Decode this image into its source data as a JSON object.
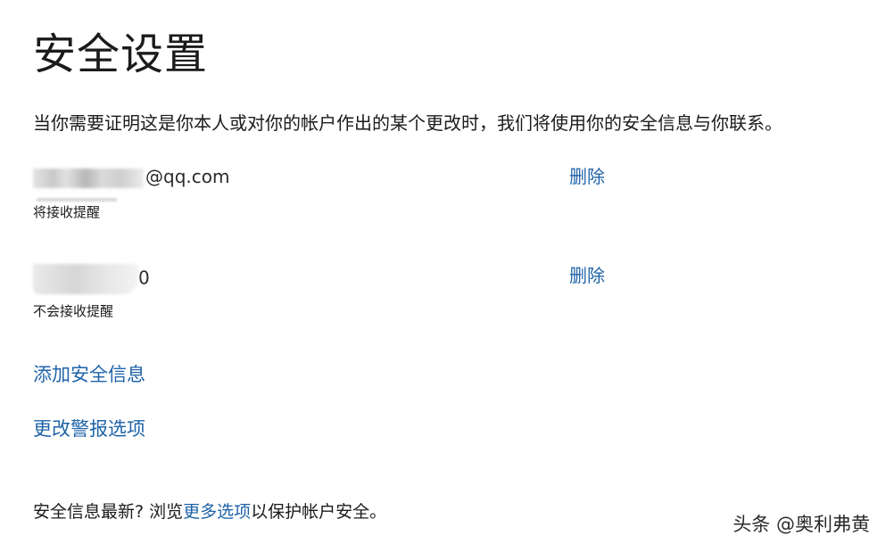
{
  "page": {
    "title": "安全设置",
    "description": "当你需要证明这是你本人或对你的帐户作出的某个更改时，我们将使用你的安全信息与你联系。"
  },
  "security_info": [
    {
      "contact_suffix": "@qq.com",
      "status": "将接收提醒",
      "delete_label": "删除"
    },
    {
      "contact_suffix": "0",
      "status": "不会接收提醒",
      "delete_label": "删除"
    }
  ],
  "links": {
    "add_info": "添加安全信息",
    "change_alerts": "更改警报选项"
  },
  "footer": {
    "prefix": "安全信息最新? 浏览",
    "link": "更多选项",
    "suffix": "以保护帐户安全。"
  },
  "watermark": "头条 @奥利弗黄"
}
